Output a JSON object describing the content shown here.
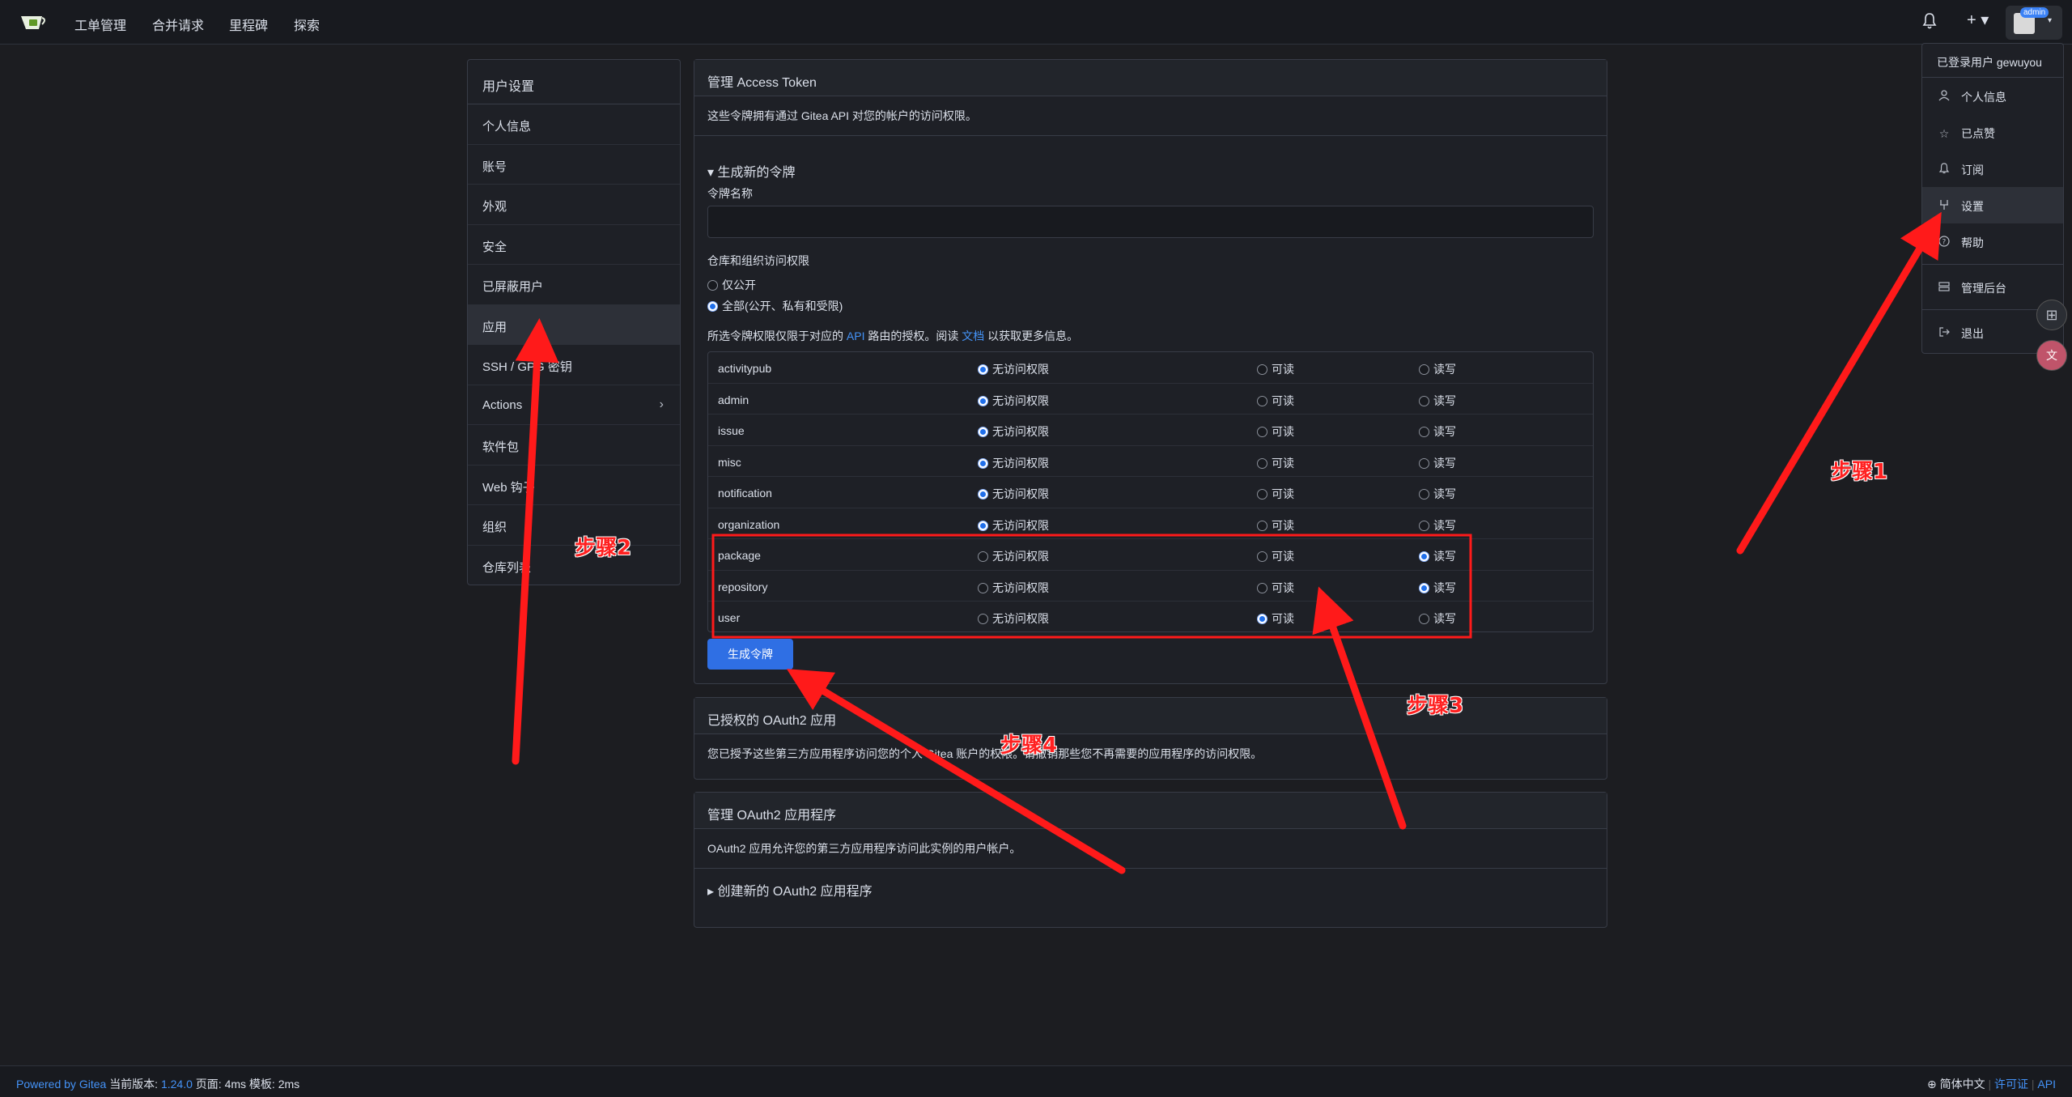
{
  "nav": {
    "items": [
      "工单管理",
      "合并请求",
      "里程碑",
      "探索"
    ],
    "plus": "+ ▾",
    "admin_badge": "admin"
  },
  "sidebar": {
    "title": "用户设置",
    "items": [
      {
        "label": "个人信息"
      },
      {
        "label": "账号"
      },
      {
        "label": "外观"
      },
      {
        "label": "安全"
      },
      {
        "label": "已屏蔽用户"
      },
      {
        "label": "应用"
      },
      {
        "label": "SSH / GPG 密钥"
      },
      {
        "label": "Actions"
      },
      {
        "label": "软件包"
      },
      {
        "label": "Web 钩子"
      },
      {
        "label": "组织"
      },
      {
        "label": "仓库列表"
      }
    ]
  },
  "tokens": {
    "title": "管理 Access Token",
    "desc": "这些令牌拥有通过 Gitea API 对您的帐户的访问权限。",
    "generate_toggle": "▾ 生成新的令牌",
    "name_label": "令牌名称",
    "name_value": "",
    "repo_access_label": "仓库和组织访问权限",
    "repo_opt_public": "仅公开",
    "repo_opt_all": "全部(公开、私有和受限)",
    "scope_note_pre": "所选令牌权限仅限于对应的",
    "scope_note_api": "API",
    "scope_note_mid": "路由的授权。阅读",
    "scope_note_doc": "文档",
    "scope_note_post": "以获取更多信息。",
    "opt_none": "无访问权限",
    "opt_read": "可读",
    "opt_write": "读写",
    "permissions": [
      {
        "name": "activitypub",
        "selected": "none"
      },
      {
        "name": "admin",
        "selected": "none"
      },
      {
        "name": "issue",
        "selected": "none"
      },
      {
        "name": "misc",
        "selected": "none"
      },
      {
        "name": "notification",
        "selected": "none"
      },
      {
        "name": "organization",
        "selected": "none"
      },
      {
        "name": "package",
        "selected": "write"
      },
      {
        "name": "repository",
        "selected": "write"
      },
      {
        "name": "user",
        "selected": "read"
      }
    ],
    "generate_button": "生成令牌"
  },
  "oauth_authorized": {
    "title": "已授权的 OAuth2 应用",
    "desc": "您已授予这些第三方应用程序访问您的个人 Gitea 账户的权限。请撤销那些您不再需要的应用程序的访问权限。"
  },
  "oauth_manage": {
    "title": "管理 OAuth2 应用程序",
    "desc": "OAuth2 应用允许您的第三方应用程序访问此实例的用户帐户。",
    "create_toggle": "▸ 创建新的 OAuth2 应用程序"
  },
  "dropdown": {
    "signed_in": "已登录用户 gewuyou",
    "items": [
      {
        "label": "个人信息",
        "icon": "person-icon"
      },
      {
        "label": "已点赞",
        "icon": "star-icon"
      },
      {
        "label": "订阅",
        "icon": "bell-icon"
      },
      {
        "label": "设置",
        "icon": "tools-icon"
      },
      {
        "label": "帮助",
        "icon": "help-icon"
      },
      {
        "label": "管理后台",
        "icon": "server-icon"
      },
      {
        "label": "退出",
        "icon": "sign-out-icon"
      }
    ]
  },
  "footer": {
    "powered": "Powered by Gitea",
    "version_label": "当前版本:",
    "version": "1.24.0",
    "timing": "页面: 4ms 模板: 2ms",
    "language": "简体中文",
    "license": "许可证",
    "api": "API"
  },
  "annotations": [
    "步骤1",
    "步骤2",
    "步骤3",
    "步骤4"
  ],
  "colors": {
    "accent": "#2f6fe4",
    "annotation": "#ff2020",
    "background": "#1c1d21"
  }
}
